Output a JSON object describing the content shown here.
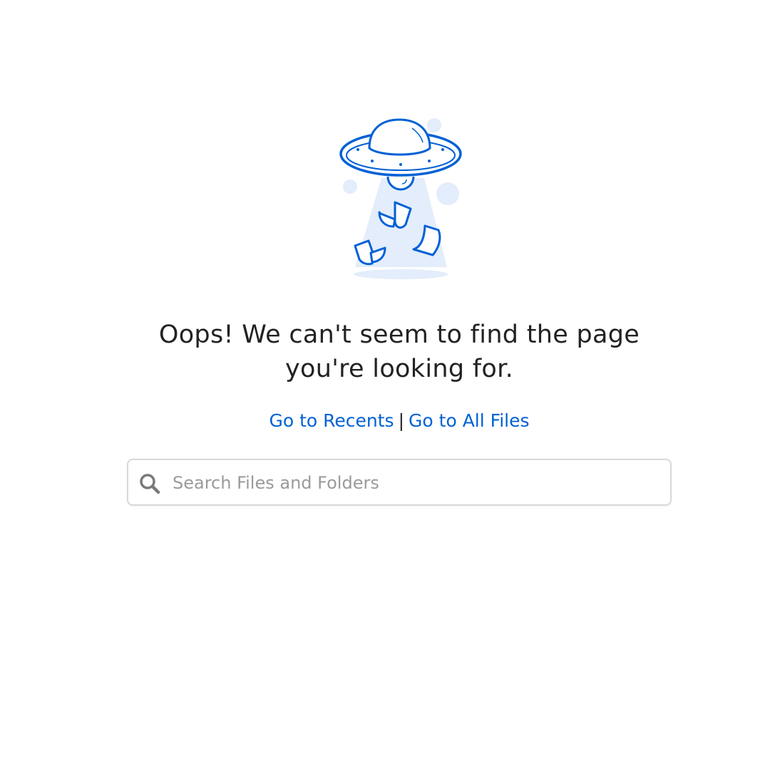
{
  "error": {
    "illustration_icon": "ufo-abducting-files-icon",
    "message_line1": "Oops! We can't seem to find the page",
    "message_line2": "you're looking for."
  },
  "links": {
    "recents_label": "Go to Recents",
    "separator": "|",
    "all_files_label": "Go to All Files"
  },
  "search": {
    "icon": "search-icon",
    "placeholder": "Search Files and Folders",
    "value": ""
  },
  "colors": {
    "accent": "#0061d5",
    "light_accent": "#e3edfb",
    "text": "#222222",
    "placeholder": "#9a9a9a",
    "border": "#d9d9d9"
  }
}
